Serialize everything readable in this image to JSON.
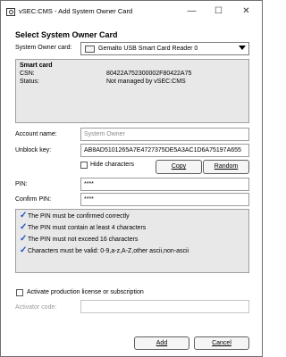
{
  "window": {
    "title": "vSEC:CMS - Add System Owner Card",
    "controls": {
      "minimize": "—",
      "maximize": "☐",
      "close": "✕"
    }
  },
  "form": {
    "heading": "Select System Owner Card",
    "system_owner_card_label": "System Owner card:",
    "system_owner_card_value": "Gemalto USB Smart Card Reader 0",
    "smart_card": {
      "title": "Smart card",
      "csn_label": "CSN:",
      "csn_value": "80422A752300002F80422A75",
      "status_label": "Status:",
      "status_value": "Not managed by vSEC:CMS"
    },
    "account_name_label": "Account name:",
    "account_name_placeholder": "System Owner",
    "unblock_key_label": "Unblock key:",
    "unblock_key_value": "AB8AD5101265A7E4727375DE5A3AC1D6A75197A655",
    "hide_characters_label": "Hide characters",
    "copy_button": "Copy",
    "random_button": "Random",
    "pin_label": "PIN:",
    "pin_value": "****",
    "confirm_pin_label": "Confirm PIN:",
    "confirm_pin_value": "****",
    "rules": [
      "The PIN must be confirmed correctly",
      "The PIN must contain at least 4 characters",
      "The PIN must not exceed 16 characters",
      "Characters must be valid: 0-9,a-z,A-Z,other ascii,non-ascii"
    ],
    "activate_label": "Activate production license or subscription",
    "activator_code_label": "Activator code:",
    "activator_code_value": "",
    "add_button": "Add",
    "cancel_button": "Cancel"
  },
  "icons": {
    "app": "shield-icon",
    "dropdown": "chevron-down-icon",
    "reader": "card-reader-icon",
    "rule_status": "checkmark-icon"
  },
  "colors": {
    "panel_background": "#e8e8e8",
    "check": "#1e55c9",
    "disabled_text": "#9a9a9a"
  }
}
